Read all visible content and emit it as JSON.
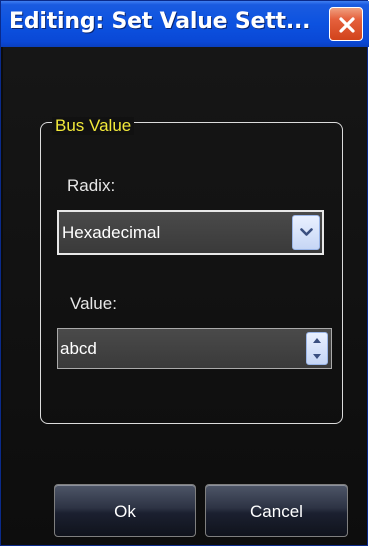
{
  "window": {
    "title": "Editing: Set Value Sett...",
    "close_icon": "close-icon"
  },
  "group": {
    "label": "Bus Value"
  },
  "radix": {
    "label": "Radix:",
    "selected": "Hexadecimal",
    "arrow_icon": "chevron-down-icon"
  },
  "value": {
    "label": "Value:",
    "current": "abcd",
    "up_icon": "spin-up-icon",
    "down_icon": "spin-down-icon"
  },
  "buttons": {
    "ok_label": "Ok",
    "cancel_label": "Cancel"
  },
  "colors": {
    "title_bar": "#0c52e0",
    "group_label": "#f2e93a",
    "close_button": "#d2431b",
    "background": "#111111"
  }
}
